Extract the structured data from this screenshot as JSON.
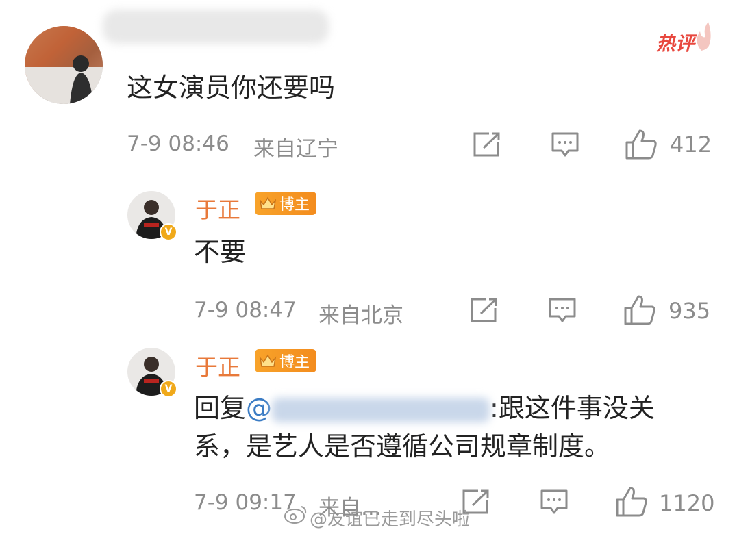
{
  "comment": {
    "hot_badge": "热评",
    "content": "这女演员你还要吗",
    "time": "7-9 08:46",
    "location": "来自辽宁",
    "likes": "412"
  },
  "replies": [
    {
      "author": "于正",
      "badge": "博主",
      "content": "不要",
      "time": "7-9 08:47",
      "location": "来自北京",
      "likes": "935"
    },
    {
      "author": "于正",
      "badge": "博主",
      "content_prefix": "回复",
      "mention": "@",
      "content_line1": ":跟这件事没关",
      "content_line2": "系，是艺人是否遵循公司规章制度。",
      "time": "7-9 09:17",
      "location": "来自...",
      "likes": "1120"
    }
  ],
  "watermark": "@友谊已走到尽头啦",
  "colors": {
    "author_orange": "#e8793a",
    "mention_blue": "#3b7cc4",
    "hot_red": "#e8483f",
    "meta_gray": "#8c8c8c"
  }
}
